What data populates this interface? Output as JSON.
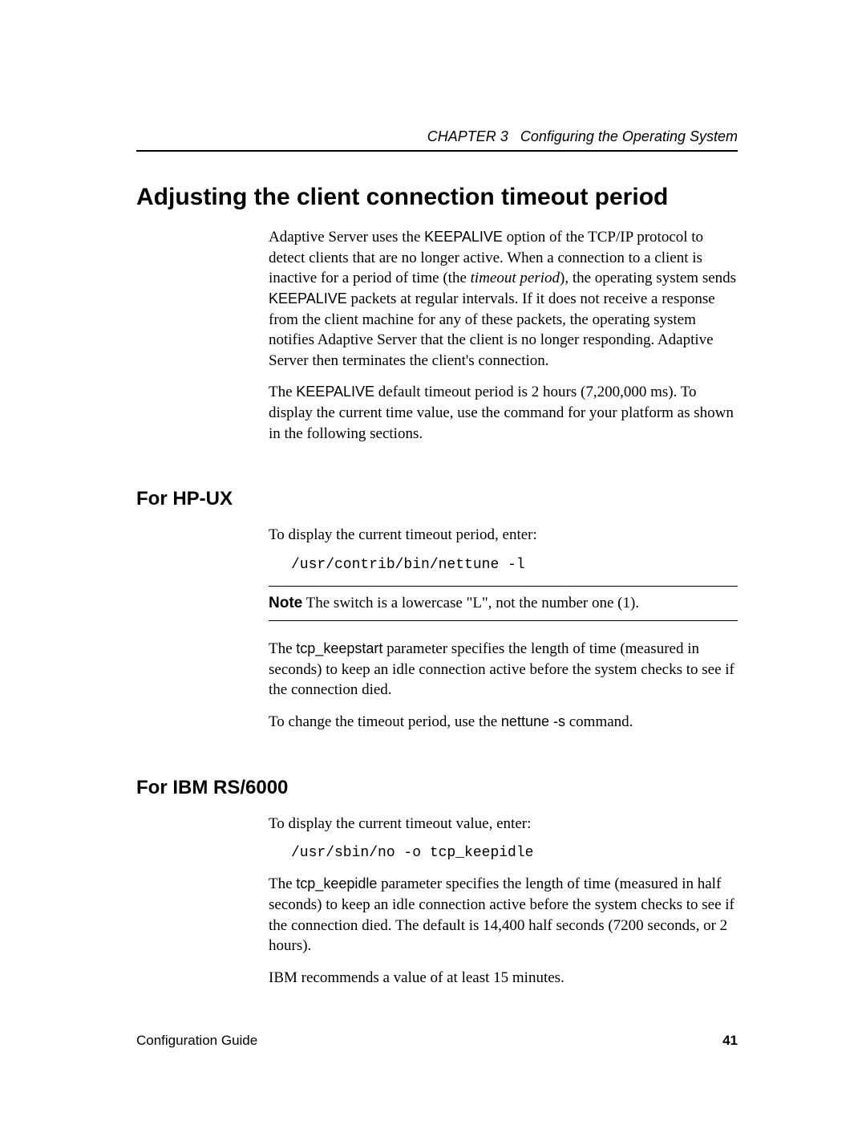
{
  "header": {
    "chapter_label": "CHAPTER 3",
    "chapter_title": "Configuring the Operating System"
  },
  "main": {
    "title": "Adjusting the client connection timeout period",
    "intro_p1": {
      "pre1": "Adaptive Server uses the ",
      "kw1": "KEEPALIVE",
      "mid1": " option of the TCP/IP protocol to detect clients that are no longer active. When a connection to a client is inactive for a period of time (the ",
      "ital": "timeout period",
      "mid2": "), the operating system sends ",
      "kw2": "KEEPALIVE",
      "post": " packets at regular intervals. If it does not receive a response from the client machine for any of these packets, the operating system notifies Adaptive Server that the client is no longer responding. Adaptive Server then terminates the client's connection."
    },
    "intro_p2": {
      "pre": "The ",
      "kw": "KEEPALIVE",
      "post": " default timeout period is 2 hours (7,200,000 ms). To display the current time value, use the command for your platform as shown in the following sections."
    }
  },
  "hpux": {
    "title": "For HP-UX",
    "p1": "To display the current timeout period, enter:",
    "cmd": "/usr/contrib/bin/nettune -l",
    "note_label": "Note",
    "note_text": "  The switch is a lowercase \"L\", not the number one (1).",
    "p2": {
      "pre": "The ",
      "kw": "tcp_keepstart",
      "post": " parameter specifies the length of time (measured in seconds) to keep an idle connection active before the system checks to see if the connection died."
    },
    "p3": {
      "pre": "To change the timeout period, use the ",
      "kw": "nettune -s",
      "post": " command."
    }
  },
  "ibm": {
    "title": "For IBM RS/6000",
    "p1": "To display the current timeout value, enter:",
    "cmd": "/usr/sbin/no -o tcp_keepidle",
    "p2": {
      "pre": "The ",
      "kw": "tcp_keepidle",
      "post": " parameter specifies the length of time (measured in half seconds) to keep an idle connection active before the system checks to see if the connection died. The default is 14,400 half seconds (7200 seconds, or 2 hours)."
    },
    "p3": "IBM recommends a value of at least 15 minutes."
  },
  "footer": {
    "guide": "Configuration Guide",
    "page": "41"
  }
}
